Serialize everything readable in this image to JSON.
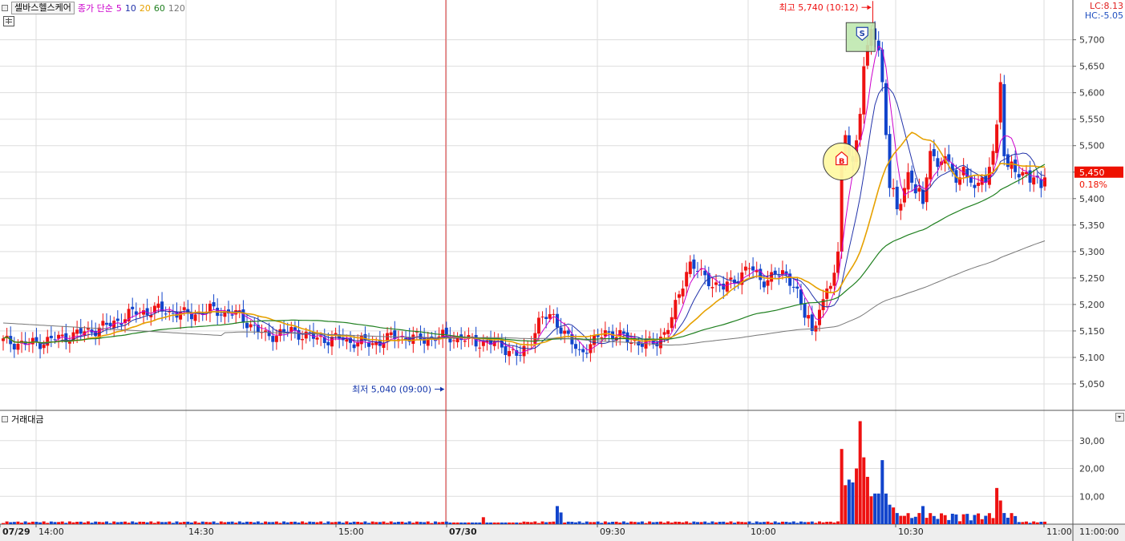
{
  "legend": {
    "stock_name": "셀바스헬스케어",
    "ma_label": "종가 단순",
    "ma_periods": [
      "5",
      "10",
      "20",
      "60",
      "120"
    ],
    "ma_colors": [
      "#cc00cc",
      "#2233aa",
      "#e6a100",
      "#208020",
      "#777777"
    ]
  },
  "right_info": {
    "lc": "LC:8.13",
    "hc": "HC:-5.05"
  },
  "price_axis": {
    "ticks": [
      "5,700",
      "5,650",
      "5,600",
      "5,550",
      "5,500",
      "5,450",
      "5,400",
      "5,350",
      "5,300",
      "5,250",
      "5,200",
      "5,150",
      "5,100",
      "5,050"
    ]
  },
  "last_price": {
    "label": "5,450",
    "change": "0.18%",
    "color": "#ee1100"
  },
  "annotations": {
    "high": "최고 5,740 (10:12)",
    "low": "최저 5,040 (09:00)",
    "sell_marker": "S",
    "buy_marker": "B"
  },
  "volume_panel": {
    "title": "거래대금",
    "ticks": [
      "30,00",
      "20,00",
      "10,00"
    ]
  },
  "time_axis": {
    "labels": [
      {
        "text": "07/29",
        "bold": true
      },
      {
        "text": "14:00"
      },
      {
        "text": "14:30"
      },
      {
        "text": "15:00"
      },
      {
        "text": "07/30",
        "bold": true
      },
      {
        "text": "09:30"
      },
      {
        "text": "10:00"
      },
      {
        "text": "10:30"
      },
      {
        "text": "11:00"
      }
    ],
    "corner": "11:00:00"
  },
  "colors": {
    "up": "#ee1111",
    "down": "#1144cc",
    "day_divider": "#dd3333"
  },
  "chart_data": {
    "type": "candlestick",
    "title": "셀바스헬스케어",
    "y_range": [
      5000,
      5760
    ],
    "high": 5740,
    "low": 5040,
    "last_close": 5450,
    "moving_averages": [
      "5",
      "10",
      "20",
      "60",
      "120"
    ],
    "x_days": [
      "07/29",
      "07/30"
    ],
    "volume_series": "거래대금",
    "volume_range": [
      0,
      38
    ]
  }
}
